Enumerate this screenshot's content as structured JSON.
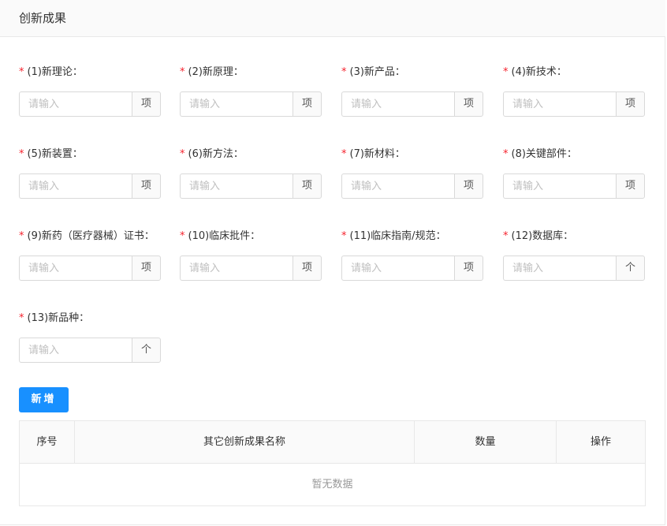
{
  "header": {
    "title": "创新成果"
  },
  "placeholder": "请输入",
  "fields": [
    {
      "label": "(1)新理论：",
      "unit": "项"
    },
    {
      "label": "(2)新原理：",
      "unit": "项"
    },
    {
      "label": "(3)新产品：",
      "unit": "项"
    },
    {
      "label": "(4)新技术：",
      "unit": "项"
    },
    {
      "label": "(5)新装置：",
      "unit": "项"
    },
    {
      "label": "(6)新方法：",
      "unit": "项"
    },
    {
      "label": "(7)新材料：",
      "unit": "项"
    },
    {
      "label": "(8)关键部件：",
      "unit": "项"
    },
    {
      "label": "(9)新药（医疗器械）证书：",
      "unit": "项"
    },
    {
      "label": "(10)临床批件：",
      "unit": "项"
    },
    {
      "label": "(11)临床指南/规范：",
      "unit": "项"
    },
    {
      "label": "(12)数据库：",
      "unit": "个"
    },
    {
      "label": "(13)新品种：",
      "unit": "个"
    }
  ],
  "required_mark": "*",
  "add_button": {
    "label": "新增"
  },
  "table": {
    "columns": [
      "序号",
      "其它创新成果名称",
      "数量",
      "操作"
    ],
    "empty_text": "暂无数据"
  },
  "colors": {
    "primary": "#1890ff",
    "required": "#f5222d"
  }
}
